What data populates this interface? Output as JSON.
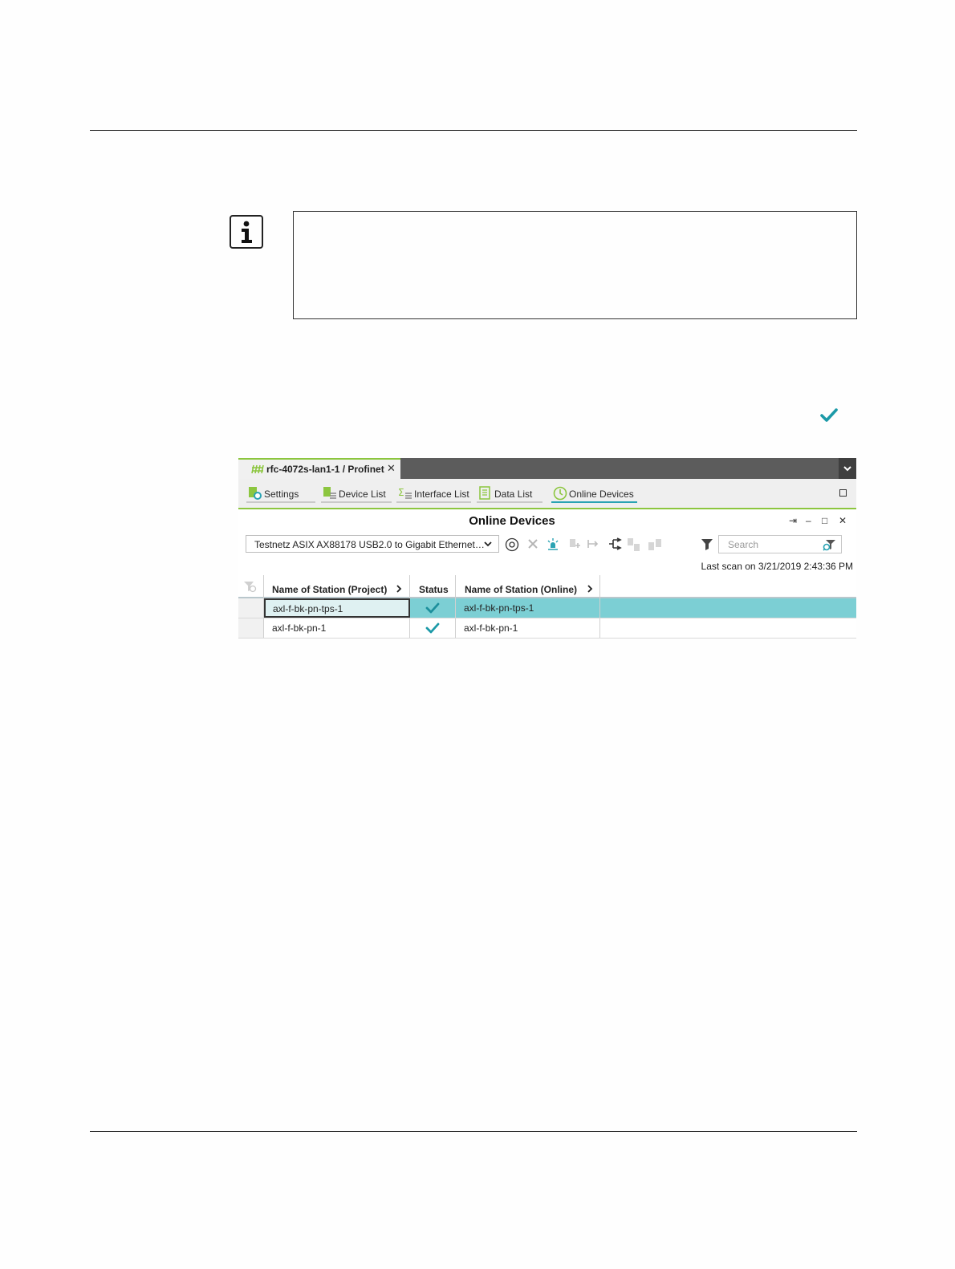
{
  "panel": {
    "doc_tab_title": "rfc-4072s-lan1-1 / Profinet",
    "doc_tab_close": "✕",
    "subnav": [
      {
        "label": "Settings"
      },
      {
        "label": "Device List"
      },
      {
        "label": "Interface List"
      },
      {
        "label": "Data List"
      },
      {
        "label": "Online Devices"
      }
    ],
    "view_title": "Online Devices",
    "window_controls": {
      "pin": "⇥",
      "minimize": "–",
      "restore": "□",
      "close": "✕"
    },
    "adapter_value": "Testnetz ASIX AX88178 USB2.0 to Gigabit Ethernet…",
    "search_placeholder": "Search",
    "last_scan": "Last scan on 3/21/2019 2:43:36 PM",
    "columns": [
      "Name of Station (Project)",
      "Status",
      "Name of Station (Online)"
    ],
    "rows": [
      {
        "project": "axl-f-bk-pn-tps-1",
        "status": "ok",
        "online": "axl-f-bk-pn-tps-1",
        "selected": true
      },
      {
        "project": "axl-f-bk-pn-1",
        "status": "ok",
        "online": "axl-f-bk-pn-1",
        "selected": false
      }
    ],
    "colors": {
      "accent_green": "#8cc63f",
      "teal": "#2aa3b3",
      "selected_row": "#7ccfd4"
    }
  }
}
